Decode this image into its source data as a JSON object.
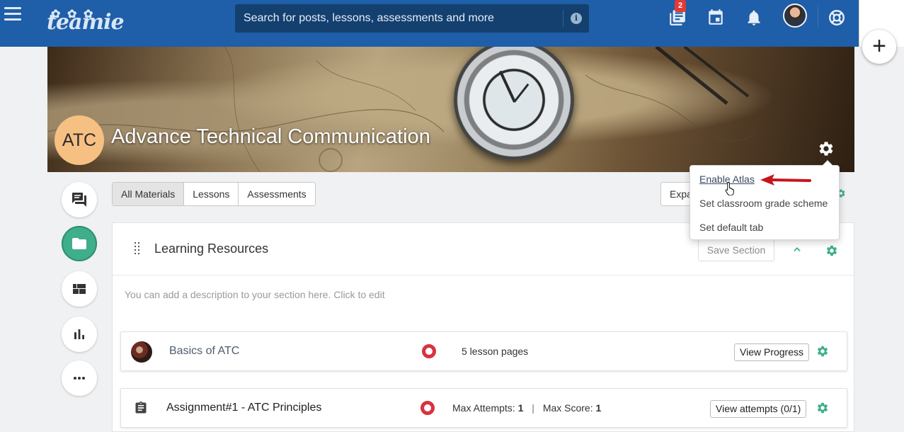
{
  "topbar": {
    "logo_text": "teamie",
    "search_placeholder": "Search for posts, lessons, assessments and more",
    "notification_badge": "2"
  },
  "classroom": {
    "initials": "ATC",
    "title": "Advance Technical Communication"
  },
  "tabs": [
    {
      "label": "All Materials",
      "active": true
    },
    {
      "label": "Lessons",
      "active": false
    },
    {
      "label": "Assessments",
      "active": false
    }
  ],
  "expand_label": "Expa",
  "settings_menu": {
    "items": [
      "Enable Atlas",
      "Set classroom grade scheme",
      "Set default tab"
    ]
  },
  "section": {
    "title": "Learning Resources",
    "save_label": "Save Section",
    "description_placeholder": "You can add a description to your section here. Click to edit"
  },
  "materials": [
    {
      "title": "Basics of ATC",
      "meta": "5 lesson pages",
      "action": "View Progress"
    },
    {
      "title": "Assignment#1 - ATC Principles",
      "max_attempts_label": "Max Attempts:",
      "max_attempts": "1",
      "max_score_label": "Max Score:",
      "max_score": "1",
      "action": "View attempts (0/1)"
    }
  ],
  "colors": {
    "topbar": "#1f5ea8",
    "search": "#13406f",
    "accent_green": "#3fae8b",
    "status_red": "#d9323f",
    "class_badge": "#f7c083"
  }
}
